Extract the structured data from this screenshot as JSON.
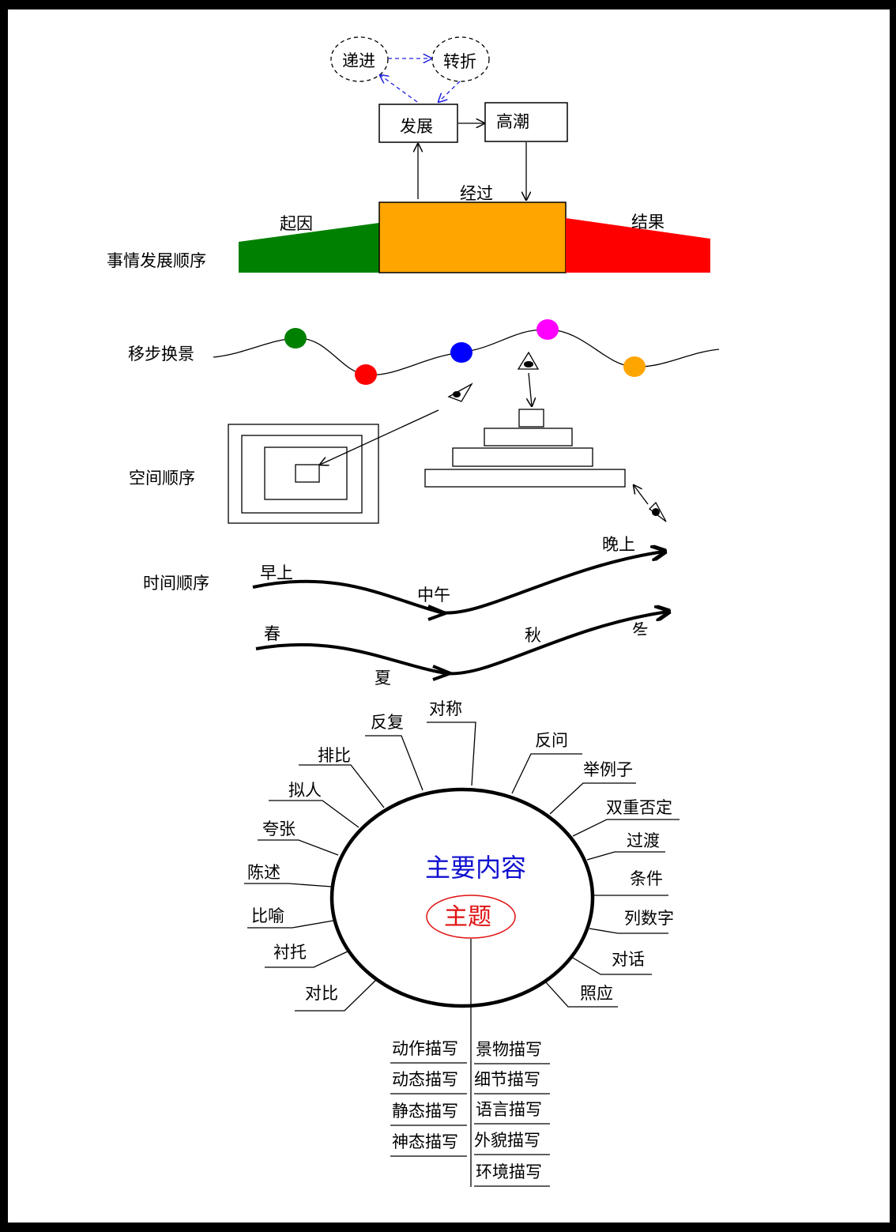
{
  "event_order": {
    "label": "事情发展顺序",
    "cause": "起因",
    "process": "经过",
    "result": "结果",
    "develop": "发展",
    "climax": "高潮",
    "progress": "递进",
    "turn": "转折",
    "colors": {
      "cause": "#008000",
      "process": "#FFA500",
      "result": "#FF0000",
      "dashed": "#2020E0"
    }
  },
  "scene_change": {
    "label": "移步换景",
    "dot_colors": [
      "#008000",
      "#FF0000",
      "#0000FF",
      "#FF00FF",
      "#FFA500"
    ]
  },
  "space_order": {
    "label": "空间顺序"
  },
  "time_order": {
    "label": "时间顺序",
    "day": [
      "早上",
      "中午",
      "晚上"
    ],
    "season": [
      "春",
      "夏",
      "秋",
      "冬"
    ]
  },
  "center": {
    "main_content": "主要内容",
    "theme": "主题",
    "techniques_left": [
      "对称",
      "反复",
      "排比",
      "拟人",
      "夸张",
      "陈述",
      "比喻",
      "衬托",
      "对比"
    ],
    "techniques_right": [
      "反问",
      "举例子",
      "双重否定",
      "过渡",
      "条件",
      "列数字",
      "对话",
      "照应"
    ],
    "description_left": [
      "动作描写",
      "动态描写",
      "静态描写",
      "神态描写"
    ],
    "description_right": [
      "景物描写",
      "细节描写",
      "语言描写",
      "外貌描写",
      "环境描写"
    ]
  }
}
